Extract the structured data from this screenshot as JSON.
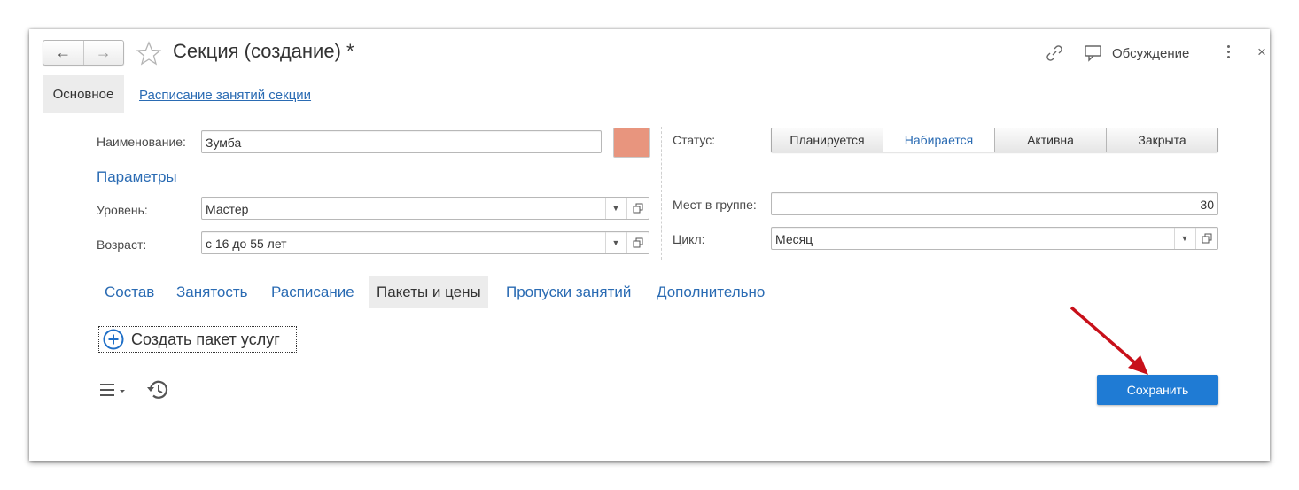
{
  "window": {
    "title": "Секция (создание) *",
    "discussion_label": "Обсуждение"
  },
  "form_tabs": [
    {
      "label": "Основное",
      "active": true
    },
    {
      "label": "Расписание занятий секции",
      "active": false
    }
  ],
  "fields": {
    "name": {
      "label": "Наименование:",
      "value": "Зумба"
    },
    "color_swatch": "#e8957e",
    "params_heading": "Параметры",
    "level": {
      "label": "Уровень:",
      "value": "Мастер"
    },
    "age": {
      "label": "Возраст:",
      "value": "с 16 до 55 лет"
    },
    "status": {
      "label": "Статус:",
      "options": [
        "Планируется",
        "Набирается",
        "Активна",
        "Закрыта"
      ],
      "selected": "Набирается"
    },
    "seats": {
      "label": "Мест в группе:",
      "value": "30"
    },
    "cycle": {
      "label": "Цикл:",
      "value": "Месяц"
    }
  },
  "sub_tabs": [
    {
      "label": "Состав",
      "active": false
    },
    {
      "label": "Занятость",
      "active": false
    },
    {
      "label": "Расписание",
      "active": false
    },
    {
      "label": "Пакеты и цены",
      "active": true
    },
    {
      "label": "Пропуски занятий",
      "active": false
    },
    {
      "label": "Дополнительно",
      "active": false
    }
  ],
  "create_package_label": "Создать пакет услуг",
  "save_label": "Сохранить",
  "colors": {
    "accent_blue": "#2a6bb3",
    "save_button": "#1f7bd4",
    "arrow_red": "#c8101a"
  },
  "icons": [
    "back-arrow-icon",
    "forward-arrow-icon",
    "star-icon",
    "link-icon",
    "discussion-icon",
    "more-vert-icon",
    "close-icon",
    "plus-circle-icon",
    "menu-icon",
    "history-icon"
  ]
}
